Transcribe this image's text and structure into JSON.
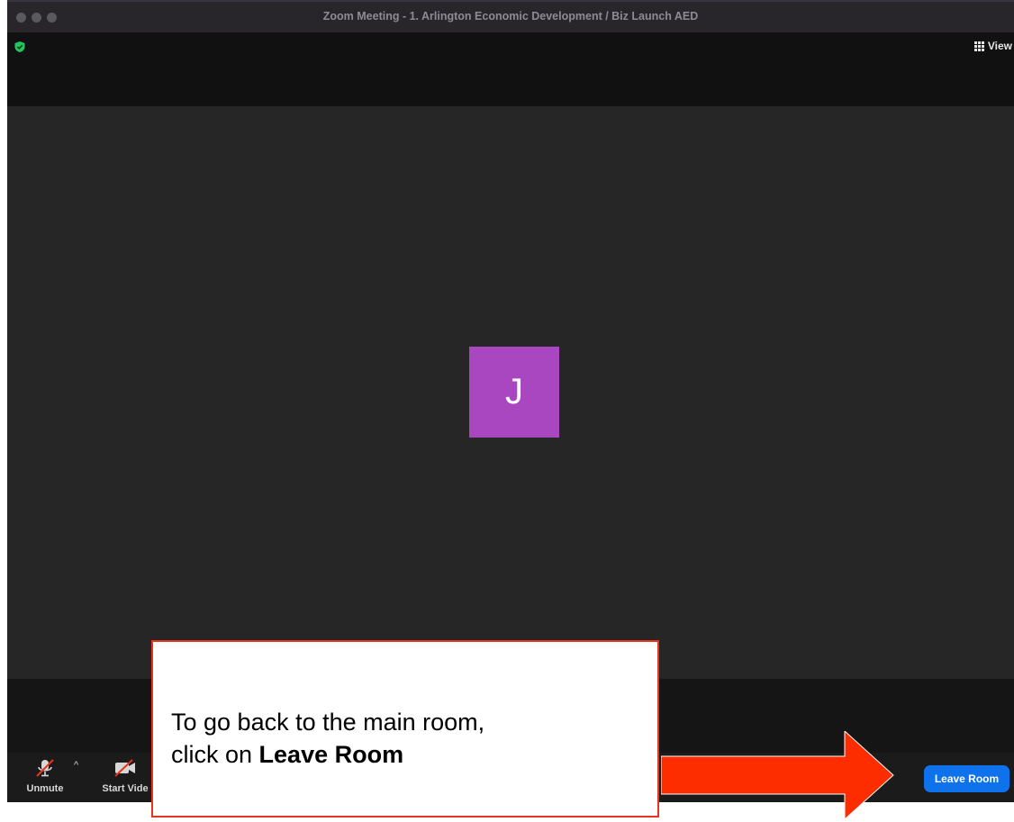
{
  "window": {
    "title": "Zoom Meeting - 1. Arlington Economic Development / Biz Launch AED"
  },
  "topbar": {
    "view_label": "View"
  },
  "participant": {
    "initial": "J"
  },
  "toolbar": {
    "unmute_label": "Unmute",
    "start_video_label": "Start Vide",
    "caret": "^",
    "leave_room_label": "Leave Room"
  },
  "callout": {
    "line1": "To go back to the main room,",
    "line2_prefix": "click on ",
    "line2_bold": "Leave Room"
  },
  "colors": {
    "avatar_bg": "#a947c1",
    "leave_button_bg": "#0e72ed",
    "arrow_red": "#fe2d00",
    "callout_border": "#e8341c",
    "shield_green": "#22c55e"
  },
  "icons": {
    "shield": "shield-check-icon",
    "view": "grid-icon",
    "mic": "microphone-muted-icon",
    "video": "video-muted-icon"
  }
}
